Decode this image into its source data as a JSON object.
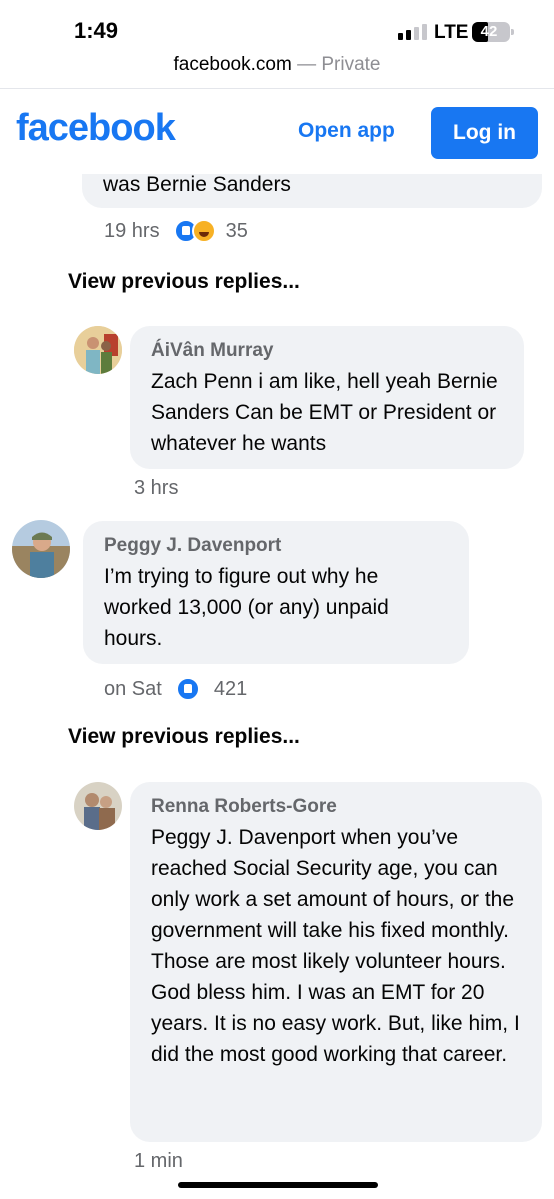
{
  "status_bar": {
    "time": "1:49",
    "network": "LTE",
    "battery_level": "42"
  },
  "browser": {
    "host": "facebook.com",
    "mode": " — Private"
  },
  "header": {
    "logo": "facebook",
    "open_app": "Open app",
    "login": "Log in"
  },
  "comments": [
    {
      "text_tail": "was Bernie Sanders",
      "time": "19 hrs",
      "reactions": [
        "like",
        "haha"
      ],
      "reaction_count": "35"
    },
    {
      "author": "ÁiVân Murray",
      "text": "Zach Penn i am like, hell yeah Bernie Sanders Can be EMT or President or whatever he wants",
      "time": "3 hrs"
    },
    {
      "author": "Peggy J. Davenport",
      "text": "I’m trying to figure out why he worked 13,000 (or any) unpaid hours.",
      "time": "on Sat",
      "reactions": [
        "like"
      ],
      "reaction_count": "421"
    },
    {
      "author": "Renna Roberts-Gore",
      "text": "Peggy J. Davenport when you’ve reached Social Security age, you can only work a set amount of hours, or the government will take his fixed monthly. Those are most likely volunteer hours. God bless him. I was an EMT for 20 years. It is no easy work. But, like him, I did the most good working that career.",
      "time": "1 min"
    }
  ],
  "view_previous_replies": [
    "View previous replies...",
    "View previous replies..."
  ],
  "colors": {
    "brand": "#1877f2",
    "bubble": "#f0f2f5",
    "meta_text": "#65676b"
  }
}
